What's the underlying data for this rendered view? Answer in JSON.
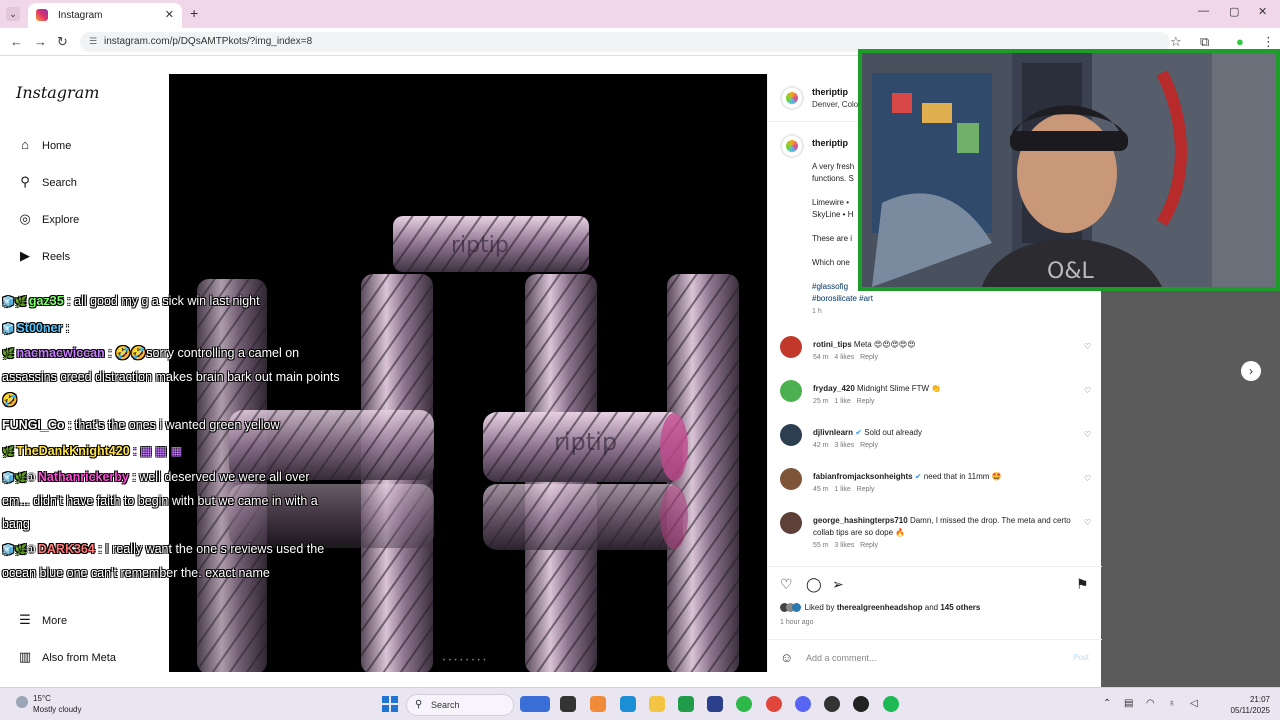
{
  "browser": {
    "tab_title": "Instagram",
    "url": "instagram.com/p/DQsAMTPkots/?img_index=8",
    "new_tab": "+",
    "close": "✕"
  },
  "sidebar": {
    "logo": "Instagram",
    "items": [
      {
        "label": "Home",
        "icon": "⌂"
      },
      {
        "label": "Search",
        "icon": "⚲"
      },
      {
        "label": "Explore",
        "icon": "◎"
      },
      {
        "label": "Reels",
        "icon": "▶"
      },
      {
        "label": "More",
        "icon": "☰"
      },
      {
        "label": "Also from Meta",
        "icon": "▥"
      }
    ]
  },
  "viewer": {
    "carousel_dots": "• • • • • • • •",
    "tube_text": "riptip"
  },
  "post": {
    "author": "theriptip",
    "location": "Denver, Colorad",
    "caption_author": "theriptip",
    "caption_lines": [
      "A very fresh",
      "functions. S",
      "",
      "Limewire •",
      "SkyLine • H",
      "",
      "These are i",
      "",
      "Which one"
    ],
    "hashtags_line1": "#glassofig",
    "hashtags_line2": "#borosilicate #art",
    "caption_age": "1 h",
    "comments": [
      {
        "user": "rotini_tips",
        "text": "Meta 😍😍😍😍😍",
        "age": "54 m",
        "likes": "4 likes",
        "reply": "Reply",
        "verified": false,
        "color": "#c0392b"
      },
      {
        "user": "fryday_420",
        "text": "Midnight Slime FTW 👏",
        "age": "25 m",
        "likes": "1 like",
        "reply": "Reply",
        "verified": false,
        "color": "#4caf50"
      },
      {
        "user": "djlivnlearn",
        "text": "Sold out already",
        "age": "42 m",
        "likes": "3 likes",
        "reply": "Reply",
        "verified": true,
        "color": "#2c3e50"
      },
      {
        "user": "fabianfromjacksonheights",
        "text": "need that in 11mm 🤩",
        "age": "45 m",
        "likes": "1 like",
        "reply": "Reply",
        "verified": true,
        "color": "#7f5539"
      },
      {
        "user": "george_hashingterps710",
        "text": "Damn, I missed the drop. The meta and certo collab tips are so dope 🔥",
        "age": "55 m",
        "likes": "3 likes",
        "reply": "Reply",
        "verified": false,
        "color": "#5d4037"
      }
    ],
    "liked_prefix": "Liked by",
    "liked_user": "therealgreenheadshop",
    "liked_and": "and",
    "liked_others": "145 others",
    "posted_ago": "1 hour ago",
    "add_comment_placeholder": "Add a comment...",
    "post_button": "Post"
  },
  "chat": {
    "messages": [
      {
        "user": "gaz35",
        "color": "#7dff6b",
        "text": ": all good my g a sick win last night",
        "badges": "🧊🌿"
      },
      {
        "user": "St00ner",
        "color": "#5bc8ff",
        "text": ":",
        "badges": "🧊"
      },
      {
        "user": "nacmacwiccan",
        "color": "#c77dff",
        "text": ": 🤣🤣sorry controlling a camel on assassins creed distraction makes brain bark out main points 🤣",
        "badges": "🌿"
      },
      {
        "user": "FUNGI_Co",
        "color": "#ffffff",
        "text": ": that's the ones i wanted green yellow",
        "badges": ""
      },
      {
        "user": "TheDankKnight420",
        "color": "#ffe34d",
        "text": ": ▦ ▦ ▦",
        "badges": "🌿"
      },
      {
        "user": "Nathanrickerby",
        "color": "#ff4fd8",
        "text": ": well deserved we were all over em... didn't have faith to begin with but we came in with a bang",
        "badges": "🧊🌿①"
      },
      {
        "user": "DARK364",
        "color": "#ff7a7a",
        "text": ": I really want the one s reviews used the ocean blue one can't remember the. exact name",
        "badges": "🧊🌿①"
      }
    ]
  },
  "taskbar": {
    "temp": "15°C",
    "weather": "Mostly cloudy",
    "search": "Search",
    "time": "21:07",
    "date": "05/11/2025"
  },
  "colors": {
    "tab_strip": "#f1d7ea",
    "cam_border": "#1e9c2a",
    "ig_link": "#00376b"
  }
}
